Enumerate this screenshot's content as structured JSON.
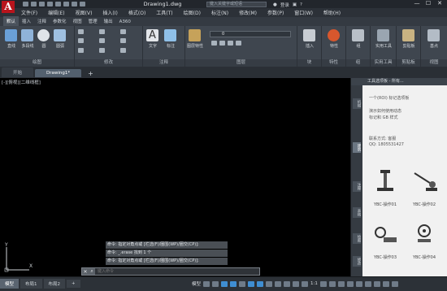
{
  "titlebar": {
    "app_logo": "A",
    "doc_title": "Drawing1.dwg",
    "search_placeholder": "键入关键字或短语",
    "user_label": "登录",
    "minimize": "—",
    "maximize": "☐",
    "close": "✕"
  },
  "menubar": [
    "文件(F)",
    "编辑(E)",
    "视图(V)",
    "插入(I)",
    "格式(O)",
    "工具(T)",
    "绘图(D)",
    "标注(N)",
    "修改(M)",
    "参数(P)",
    "窗口(W)",
    "帮助(H)"
  ],
  "ribbon_tabs": [
    "默认",
    "插入",
    "注释",
    "参数化",
    "视图",
    "管理",
    "输出",
    "A360"
  ],
  "ribbon": {
    "groups": [
      "绘图",
      "修改",
      "注释",
      "图层",
      "块",
      "特性",
      "组",
      "实用工具",
      "剪贴板",
      "视图"
    ],
    "big_buttons": {
      "line": "直线",
      "polyline": "多段线",
      "circle": "圆",
      "arc": "圆弧",
      "text": "文字",
      "dimension": "标注",
      "layer_props": "图层特性",
      "insert": "插入",
      "properties": "特性",
      "group": "组",
      "utilities": "实用工具",
      "clipboard": "剪贴板",
      "base": "基点"
    },
    "layer_current": "0"
  },
  "file_tabs": [
    "开始",
    "Drawing1*"
  ],
  "canvas": {
    "viewport_label": "[-][俯视][二维线框]",
    "ucs_x": "X",
    "ucs_y": "Y"
  },
  "command": {
    "history": [
      "命令: 指定对角点或 [栏选(F)/圈围(WP)/圈交(CP)]:",
      "命令: _.erase 找到 1 个",
      "命令: 指定对角点或 [栏选(F)/圈围(WP)/圈交(CP)]:"
    ],
    "input_placeholder": "键入命令"
  },
  "palette": {
    "title": "工具选项板 - 所有...",
    "side_tabs": [
      "机械",
      "建筑",
      "注释",
      "表格",
      "绘图",
      "修改"
    ],
    "intro_lines": [
      "一个(ROI)  标记选项板",
      "演示如何使用动态",
      "标记和 GB 样式"
    ],
    "contact_lines": [
      "联系方式: 客服",
      "QQ: 1805531427"
    ],
    "items": [
      {
        "label": "YBC-操作01"
      },
      {
        "label": "YBC-操作02"
      },
      {
        "label": "YBC-操作03"
      },
      {
        "label": "YBC-操作04"
      }
    ]
  },
  "statusbar": {
    "layout_tabs": [
      "模型",
      "布局1",
      "布局2"
    ],
    "add_tab": "+",
    "model_label": "模型",
    "scale": "1:1"
  }
}
